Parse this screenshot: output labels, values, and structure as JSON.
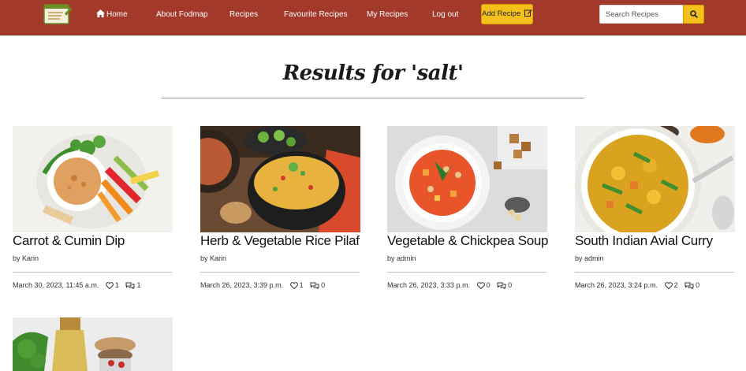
{
  "nav": {
    "home": "Home",
    "about": "About Fodmap",
    "recipes": "Recipes",
    "favourites": "Favourite Recipes",
    "my_recipes": "My Recipes",
    "logout": "Log out",
    "add_recipe": "Add Recipe",
    "search_placeholder": "Search Recipes"
  },
  "heading": "Results for 'salt'",
  "cards": [
    {
      "title": "Carrot & Cumin Dip",
      "author": "by Karin",
      "date": "March 30, 2023, 11:45 a.m.",
      "likes": "1",
      "comments": "1"
    },
    {
      "title": "Herb & Vegetable Rice Pilaf",
      "author": "by Karin",
      "date": "March 26, 2023, 3:39 p.m.",
      "likes": "1",
      "comments": "0"
    },
    {
      "title": "Vegetable & Chickpea Soup",
      "author": "by admin",
      "date": "March 26, 2023, 3:33 p.m.",
      "likes": "0",
      "comments": "0"
    },
    {
      "title": "South Indian Avial Curry",
      "author": "by admin",
      "date": "March 26, 2023, 3:24 p.m.",
      "likes": "2",
      "comments": "0"
    }
  ],
  "icons": {
    "home": "home-icon",
    "edit": "edit-icon",
    "search": "search-icon",
    "heart": "heart-icon",
    "comment": "comment-icon"
  },
  "colors": {
    "navbar": "#a3392b",
    "accent": "#f5c01b"
  }
}
